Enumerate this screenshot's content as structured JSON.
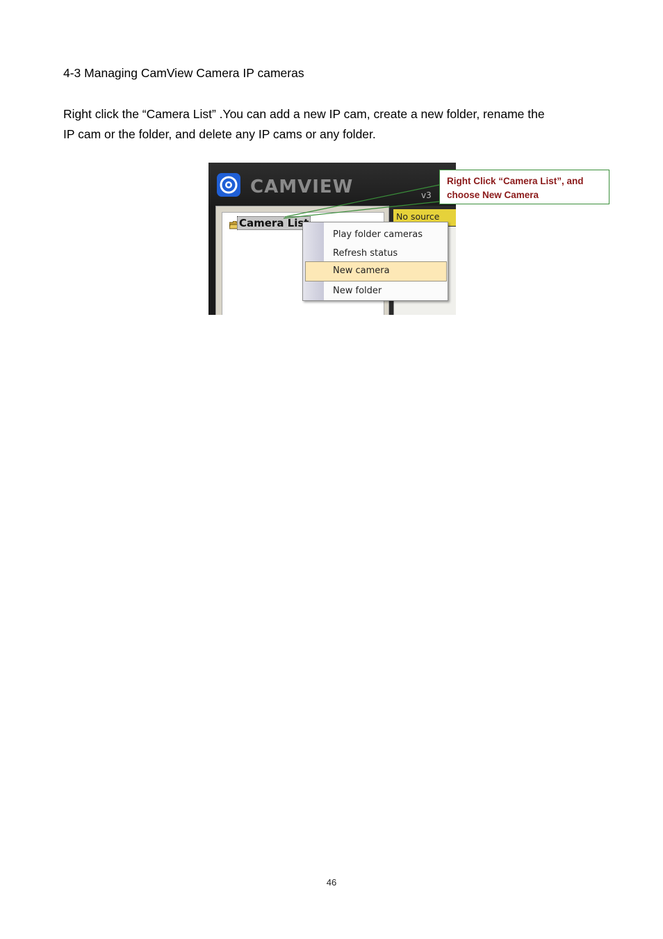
{
  "heading": "4-3 Managing CamView Camera IP cameras",
  "paragraph": {
    "line1": "Right click the “Camera List” .You can add a new IP cam, create a new folder, rename the",
    "line2": "IP cam or the folder, and delete any IP cams or any folder."
  },
  "screenshot": {
    "logo_text": "CAMVIEW",
    "version_fragment": "v3",
    "tree_label": "Camera List",
    "status_text": "No source",
    "menu_items": [
      "Play folder cameras",
      "Refresh status",
      "New camera",
      "New folder"
    ],
    "highlighted_item": "New camera",
    "icons": [
      "camview-logo-icon",
      "folder-icon"
    ]
  },
  "callout": {
    "line1": "Right Click “Camera List”, and",
    "line2": "choose New Camera",
    "text_color": "#8b1a1a",
    "border_color": "#3a8f3a"
  },
  "page_number": "46"
}
